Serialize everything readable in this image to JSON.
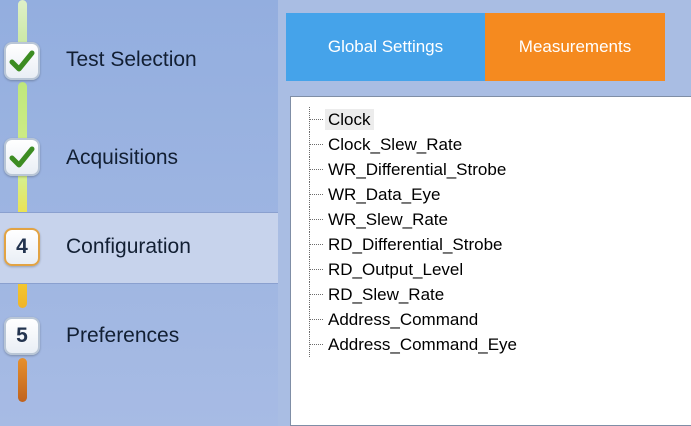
{
  "steps": [
    {
      "label": "Test Selection",
      "status": "complete",
      "icon": "check-icon"
    },
    {
      "label": "Acquisitions",
      "status": "complete",
      "icon": "check-icon"
    },
    {
      "label": "Configuration",
      "status": "active",
      "number": "4"
    },
    {
      "label": "Preferences",
      "status": "pending",
      "number": "5"
    }
  ],
  "tabs": [
    {
      "label": "Global Settings",
      "color": "#45a3ea"
    },
    {
      "label": "Measurements",
      "color": "#f58a1f",
      "selected": true
    }
  ],
  "tree": {
    "items": [
      "Clock",
      "Clock_Slew_Rate",
      "WR_Differential_Strobe",
      "WR_Data_Eye",
      "WR_Slew_Rate",
      "RD_Differential_Strobe",
      "RD_Output_Level",
      "RD_Slew_Rate",
      "Address_Command",
      "Address_Command_Eye"
    ],
    "selected_index": 0
  },
  "colors": {
    "nav_background": "#93aedf",
    "active_step": "#c7d3ec",
    "check_green": "#3c8c22"
  }
}
